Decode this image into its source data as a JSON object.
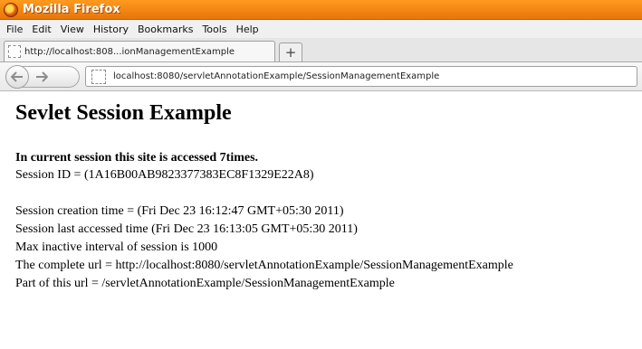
{
  "window": {
    "title": "Mozilla Firefox"
  },
  "menu": [
    "File",
    "Edit",
    "View",
    "History",
    "Bookmarks",
    "Tools",
    "Help"
  ],
  "tab": {
    "title": "http://localhost:808...ionManagementExample",
    "new_tab_label": "+"
  },
  "nav": {
    "back_icon": "back-arrow-icon",
    "forward_icon": "forward-arrow-icon",
    "url": "localhost:8080/servletAnnotationExample/SessionManagementExample"
  },
  "page": {
    "heading": "Sevlet Session Example",
    "access_count": "In current session this site is accessed 7times.",
    "session_id": "Session ID = (1A16B00AB9823377383EC8F1329E22A8)",
    "creation_time": "Session creation time = (Fri Dec 23 16:12:47 GMT+05:30 2011)",
    "last_accessed": "Session last accessed time (Fri Dec 23 16:13:05 GMT+05:30 2011)",
    "max_inactive": "Max inactive interval of session is 1000",
    "complete_url": "The complete url = http://localhost:8080/servletAnnotationExample/SessionManagementExample",
    "part_url": "Part of this url = /servletAnnotationExample/SessionManagementExample"
  }
}
